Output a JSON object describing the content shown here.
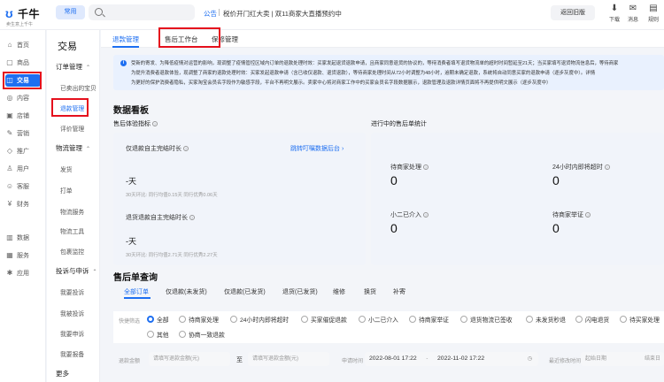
{
  "brand": {
    "name": "千牛",
    "tagline": "卖生意上千牛"
  },
  "topbar": {
    "pill": "常用",
    "notice_tag": "公告",
    "notice_text": "税价开门红大卖 | 双11商家大直播预约中",
    "back_old": "返回旧版",
    "icons": [
      {
        "icon": "download-icon",
        "glyph": "⬇",
        "label": "下载"
      },
      {
        "icon": "message-icon",
        "glyph": "✉",
        "label": "消息"
      },
      {
        "icon": "rule-icon",
        "glyph": "▤",
        "label": "规则"
      }
    ]
  },
  "rail": [
    {
      "icon": "home-icon",
      "glyph": "⌂",
      "label": "首页"
    },
    {
      "icon": "goods-icon",
      "glyph": "▢",
      "label": "商品"
    },
    {
      "icon": "trade-icon",
      "glyph": "◫",
      "label": "交易",
      "active": true
    },
    {
      "icon": "content-icon",
      "glyph": "◎",
      "label": "内容"
    },
    {
      "icon": "shop-icon",
      "glyph": "▣",
      "label": "店铺"
    },
    {
      "icon": "marketing-icon",
      "glyph": "✎",
      "label": "营销"
    },
    {
      "icon": "promotion-icon",
      "glyph": "◇",
      "label": "推广"
    },
    {
      "icon": "user-icon",
      "glyph": "♙",
      "label": "用户"
    },
    {
      "icon": "service-icon",
      "glyph": "☺",
      "label": "客服"
    },
    {
      "icon": "finance-icon",
      "glyph": "¥",
      "label": "财务"
    },
    {
      "icon": "data-icon",
      "glyph": "▥",
      "label": "数据"
    },
    {
      "icon": "services-icon",
      "glyph": "▦",
      "label": "服务"
    },
    {
      "icon": "apps-icon",
      "glyph": "✱",
      "label": "应用"
    }
  ],
  "menu2": {
    "title": "交易",
    "group1": "订单管理",
    "items1": [
      "已卖出的宝贝",
      "退款管理",
      "评价管理"
    ],
    "group2": "物流管理",
    "items2": [
      "发货",
      "打单",
      "物流服务",
      "物流工具",
      "包裹监控"
    ],
    "group3": "投诉与申诉",
    "items3": [
      "我要投诉",
      "我被投诉",
      "我要申诉",
      "我要报备"
    ],
    "more": "更多"
  },
  "tabs": [
    "退款管理",
    "售后工作台",
    "保修管理"
  ],
  "notice": {
    "line1": "受新的寄发、为降低疫情对运营的影响，现调整了疫情管控区域内订单的退款处理时效：买家发起退货退款申请，且商家同意退货的协议的，等待消费者填写退货物流单的超时时间暂延至21天；当买家填写退货物流信息后，等待商家",
    "line2": "为提升消费者退款体验，现调整了商家的退款处理时效：买家发起退款申请（含已收仅退款、退货退款），等待商家处理时间从72小时调整为48小时，逾期未确定退款，系统将自动同意买家的退款申请（逐步灰度中）。详情",
    "line3": "为更好的保护消费者隐私，买家淘宝会员名字段作为敏感字段，平台不再明文展示。卖家中心将对商家工作中的买家会员名字段数据展示，退款管理及退款详情页面将不再提供明文展示（逐步灰度中）"
  },
  "board": {
    "title": "数据看板",
    "left_title": "售后体验指标",
    "right_title": "进行中的售后单统计",
    "refund_only_label": "仅退款自主完结时长",
    "refund_only_value": "-天",
    "refund_only_sub": "30天环比:    同行均值0.15天    同行优秀0.06天",
    "return_label": "退货退款自主完结时长",
    "return_value": "-天",
    "return_sub": "30天环比:    同行均值2.71天    同行优秀2.27天",
    "jump_link": "跳转叮嘱数据后台 ›",
    "stat1_label": "待商家处理",
    "stat1_value": "0",
    "stat2_label": "24小时内即将超时",
    "stat2_value": "0",
    "stat3_label": "小二已介入",
    "stat3_value": "0",
    "stat4_label": "待商家举证",
    "stat4_value": "0"
  },
  "query": {
    "title": "售后单查询",
    "tabs": [
      "全部订单",
      "仅退款(未发货)",
      "仅退款(已发货)",
      "退货(已发货)",
      "维修",
      "换货",
      "补寄"
    ],
    "quick_label": "快捷筛选",
    "radios_row1": [
      "全部",
      "待商家处理",
      "24小时内即将超时",
      "买家催促退款",
      "小二已介入",
      "待商家举证",
      "退货物流已签收",
      "未发货秒退",
      "闪电退货",
      "待买家处理"
    ],
    "radios_row2": [
      "其他",
      "协商一致退款"
    ],
    "amount_label": "退款金额",
    "amount_from_ph": "请填写退款金额(元)",
    "amount_to": "至",
    "amount_to_ph": "请填写退款金额(元)",
    "date_label": "申请时间",
    "date_from": "2022-08-01 17:22",
    "date_sep": "-",
    "date_to": "2022-11-02 17:22",
    "last_op_label": "最近修改时间",
    "last_op_ph": "起始日期",
    "last_op_end": "结束日"
  },
  "colors": {
    "accent": "#1e6ff1",
    "highlight": "#e5101d"
  }
}
